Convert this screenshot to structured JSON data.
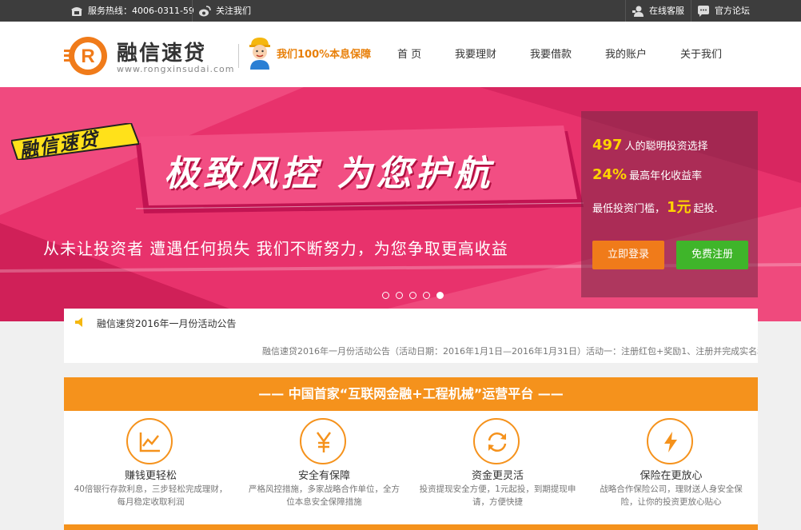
{
  "topbar": {
    "hotline": "服务热线：4006-0311-59",
    "follow": "关注我们",
    "online_service": "在线客服",
    "forum": "官方论坛"
  },
  "header": {
    "logo_name": "融信速贷",
    "logo_url": "www.rongxinsudai.com",
    "guarantee": "我们100%本息保障",
    "nav": [
      "首 页",
      "我要理财",
      "我要借款",
      "我的账户",
      "关于我们"
    ]
  },
  "banner": {
    "tag": "融信速贷",
    "headline": "极致风控 为您护航",
    "subline": "从未让投资者 遭遇任何损失 我们不断努力，为您争取更高收益",
    "slide_count": 5,
    "active_slide": 5
  },
  "login_panel": {
    "investors_num": "497",
    "investors_text": "人的聪明投资选择",
    "rate_num": "24%",
    "rate_text": "最高年化收益率",
    "threshold_prefix": "最低投资门槛，",
    "threshold_num": "1元",
    "threshold_suffix": "起投.",
    "login_label": "立即登录",
    "register_label": "免费注册"
  },
  "notice": {
    "title": "融信速贷2016年一月份活动公告",
    "text": "融信速贷2016年一月份活动公告（活动日期：2016年1月1日—2016年1月31日）活动一：注册红包+奖励1、注册并完成实名和手机认"
  },
  "features": {
    "heading": "—— 中国首家“互联网金融+工程机械”运营平台 ——",
    "items": [
      {
        "title": "赚钱更轻松",
        "desc": "40倍银行存款利息，三步轻松完成理财，每月稳定收取利润",
        "icon": "chart-icon"
      },
      {
        "title": "安全有保障",
        "desc": "严格风控措施，多家战略合作单位，全方位本息安全保障措施",
        "icon": "yen-icon"
      },
      {
        "title": "资金更灵活",
        "desc": "投资提现安全方便，1元起投，到期提现申请，方便快捷",
        "icon": "refresh-icon"
      },
      {
        "title": "保险在更放心",
        "desc": "战略合作保险公司，理财送人身安全保险，让你的投资更放心贴心",
        "icon": "lightning-icon"
      }
    ]
  },
  "colors": {
    "accent": "#f5921c",
    "banner": "#e8326c",
    "login_btn": "#f07b1a",
    "register_btn": "#3fb52a"
  }
}
